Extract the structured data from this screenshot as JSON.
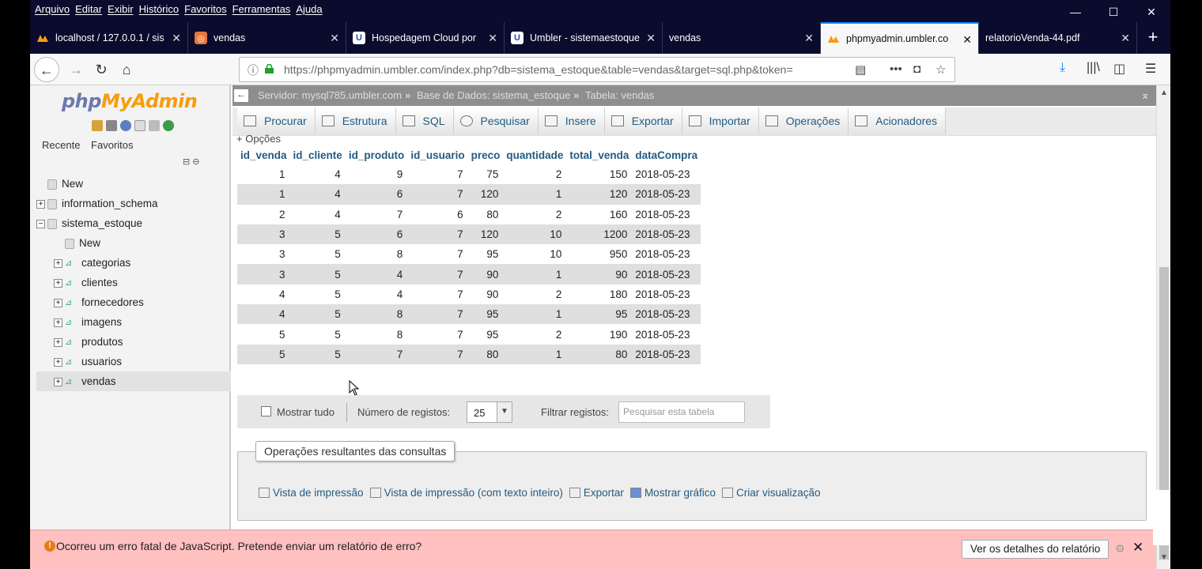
{
  "menubar": {
    "items": [
      "Arquivo",
      "Editar",
      "Exibir",
      "Histórico",
      "Favoritos",
      "Ferramentas",
      "Ajuda"
    ]
  },
  "window_controls": {
    "minimize": "—",
    "maximize": "☐",
    "close": "✕"
  },
  "tabs": [
    {
      "label": "localhost / 127.0.0.1 / sis",
      "icon": "pma-icon"
    },
    {
      "label": "vendas",
      "icon": "orange-icon"
    },
    {
      "label": "Hospedagem Cloud por",
      "icon": "umbler-icon"
    },
    {
      "label": "Umbler - sistemaestoque",
      "icon": "umbler-icon"
    },
    {
      "label": "vendas",
      "icon": ""
    },
    {
      "label": "phpmyadmin.umbler.co",
      "icon": "pma-icon"
    },
    {
      "label": "relatorioVenda-44.pdf",
      "icon": ""
    }
  ],
  "newtab": "+",
  "nav": {
    "url": "https://phpmyadmin.umbler.com/index.php?db=sistema_estoque&table=vendas&target=sql.php&token=",
    "back": "←",
    "forward": "→",
    "reload": "↻",
    "home": "⌂"
  },
  "sidebar": {
    "logo_php": "php",
    "logo_my": "MyAdmin",
    "tab_recent": "Recente",
    "tab_favorites": "Favoritos",
    "tree": [
      {
        "label": "New",
        "level": 0,
        "type": "new"
      },
      {
        "label": "information_schema",
        "level": 0,
        "type": "db"
      },
      {
        "label": "sistema_estoque",
        "level": 0,
        "type": "db"
      },
      {
        "label": "New",
        "level": 1,
        "type": "new"
      },
      {
        "label": "categorias",
        "level": 1,
        "type": "table"
      },
      {
        "label": "clientes",
        "level": 1,
        "type": "table"
      },
      {
        "label": "fornecedores",
        "level": 1,
        "type": "table"
      },
      {
        "label": "imagens",
        "level": 1,
        "type": "table"
      },
      {
        "label": "produtos",
        "level": 1,
        "type": "table"
      },
      {
        "label": "usuarios",
        "level": 1,
        "type": "table"
      },
      {
        "label": "vendas",
        "level": 1,
        "type": "table"
      }
    ]
  },
  "breadcrumb": {
    "server": "Servidor: mysql785.umbler.com",
    "database": "Base de Dados: sistema_estoque",
    "table": "Tabela: vendas"
  },
  "menu": [
    "Procurar",
    "Estrutura",
    "SQL",
    "Pesquisar",
    "Insere",
    "Exportar",
    "Importar",
    "Operações",
    "Acionadores"
  ],
  "opcoes": "+ Opções",
  "table": {
    "headers": [
      "id_venda",
      "id_cliente",
      "id_produto",
      "id_usuario",
      "preco",
      "quantidade",
      "total_venda",
      "dataCompra"
    ],
    "rows": [
      [
        "1",
        "4",
        "9",
        "7",
        "75",
        "2",
        "150",
        "2018-05-23"
      ],
      [
        "1",
        "4",
        "6",
        "7",
        "120",
        "1",
        "120",
        "2018-05-23"
      ],
      [
        "2",
        "4",
        "7",
        "6",
        "80",
        "2",
        "160",
        "2018-05-23"
      ],
      [
        "3",
        "5",
        "6",
        "7",
        "120",
        "10",
        "1200",
        "2018-05-23"
      ],
      [
        "3",
        "5",
        "8",
        "7",
        "95",
        "10",
        "950",
        "2018-05-23"
      ],
      [
        "3",
        "5",
        "4",
        "7",
        "90",
        "1",
        "90",
        "2018-05-23"
      ],
      [
        "4",
        "5",
        "4",
        "7",
        "90",
        "2",
        "180",
        "2018-05-23"
      ],
      [
        "4",
        "5",
        "8",
        "7",
        "95",
        "1",
        "95",
        "2018-05-23"
      ],
      [
        "5",
        "5",
        "8",
        "7",
        "95",
        "2",
        "190",
        "2018-05-23"
      ],
      [
        "5",
        "5",
        "7",
        "7",
        "80",
        "1",
        "80",
        "2018-05-23"
      ]
    ]
  },
  "navigation": {
    "show_all": "Mostrar tudo",
    "num_records_label": "Número de registos:",
    "num_records_value": "25",
    "filter_label": "Filtrar registos:",
    "filter_placeholder": "Pesquisar esta tabela"
  },
  "operations": {
    "legend": "Operações resultantes das consultas",
    "links": [
      "Vista de impressão",
      "Vista de impressão (com texto inteiro)",
      "Exportar",
      "Mostrar gráfico",
      "Criar visualização"
    ]
  },
  "notification": {
    "text": "Ocorreu um erro fatal de JavaScript. Pretende enviar um relatório de erro?",
    "button": "Ver os detalhes do relatório",
    "close": "✕"
  }
}
